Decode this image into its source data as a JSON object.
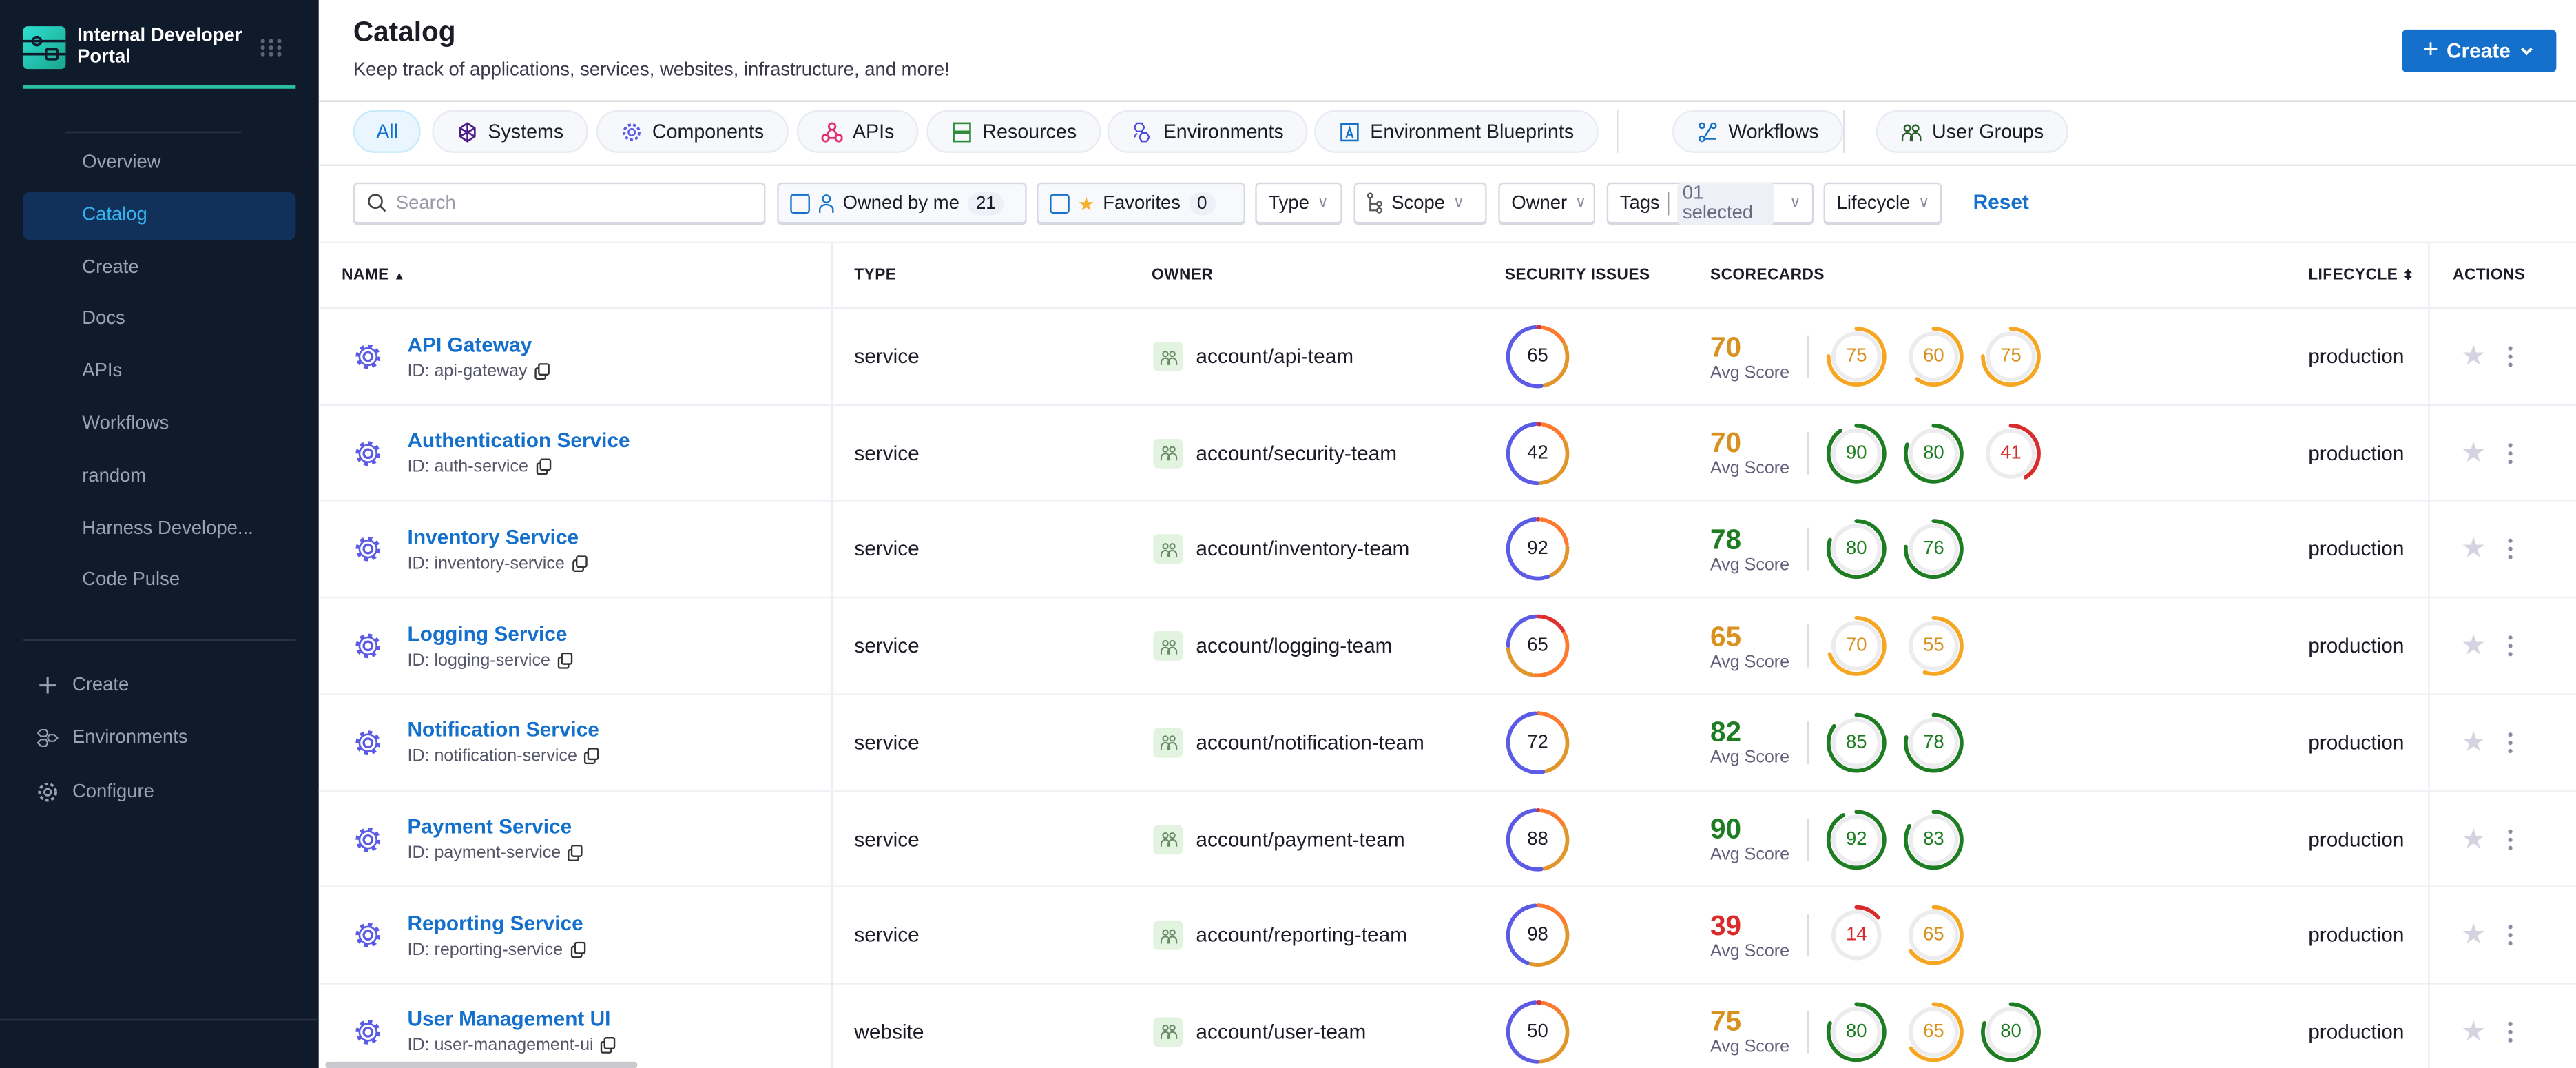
{
  "app": {
    "title": "Internal Developer Portal"
  },
  "sidebar": {
    "items": [
      {
        "label": "Overview"
      },
      {
        "label": "Catalog",
        "active": true
      },
      {
        "label": "Create"
      },
      {
        "label": "Docs"
      },
      {
        "label": "APIs"
      },
      {
        "label": "Workflows"
      },
      {
        "label": "random"
      },
      {
        "label": "Harness Develope..."
      },
      {
        "label": "Code Pulse"
      }
    ],
    "bottom": [
      {
        "label": "Create",
        "icon": "plus-icon"
      },
      {
        "label": "Environments",
        "icon": "environments-icon"
      },
      {
        "label": "Configure",
        "icon": "gear-icon"
      }
    ]
  },
  "header": {
    "title": "Catalog",
    "subtitle": "Keep track of applications, services, websites, infrastructure, and more!",
    "create_label": "Create"
  },
  "tabs": [
    {
      "label": "All",
      "active": true
    },
    {
      "label": "Systems",
      "icon": "systems-icon",
      "color": "#4a1d8a"
    },
    {
      "label": "Components",
      "icon": "gear-icon",
      "color": "#5b5be6"
    },
    {
      "label": "APIs",
      "icon": "webhook-icon",
      "color": "#e0336e"
    },
    {
      "label": "Resources",
      "icon": "server-icon",
      "color": "#2e8b3a"
    },
    {
      "label": "Environments",
      "icon": "hexagons-icon",
      "color": "#4b4be0"
    },
    {
      "label": "Environment Blueprints",
      "icon": "blueprint-icon",
      "color": "#1570cc"
    },
    {
      "label": "Workflows",
      "icon": "workflow-icon",
      "color": "#1570cc"
    },
    {
      "label": "User Groups",
      "icon": "user-group-icon",
      "color": "#2a5e2a"
    }
  ],
  "filters": {
    "search_placeholder": "Search",
    "owned_label": "Owned by me",
    "owned_count": "21",
    "favorites_label": "Favorites",
    "favorites_count": "0",
    "type_label": "Type",
    "scope_label": "Scope",
    "owner_label": "Owner",
    "tags_label": "Tags",
    "tags_value": "01 selected",
    "lifecycle_label": "Lifecycle",
    "reset_label": "Reset"
  },
  "table": {
    "columns": {
      "name": "NAME",
      "type": "TYPE",
      "owner": "OWNER",
      "security": "SECURITY ISSUES",
      "scorecards": "SCORECARDS",
      "lifecycle": "LIFECYCLE",
      "actions": "ACTIONS"
    },
    "avg_label": "Avg Score",
    "security_colors": [
      "#e03030",
      "#ff7a2e",
      "#e0962a",
      "#5b5be6"
    ],
    "rows": [
      {
        "name": "API Gateway",
        "id": "ID: api-gateway",
        "type": "service",
        "owner": "account/api-team",
        "security": "65",
        "security_split": [
          0.03,
          0.15,
          0.3,
          0.52
        ],
        "avg": "70",
        "scores": [
          75,
          60,
          75
        ],
        "lifecycle": "production"
      },
      {
        "name": "Authentication Service",
        "id": "ID: auth-service",
        "type": "service",
        "owner": "account/security-team",
        "security": "42",
        "security_split": [
          0.03,
          0.15,
          0.32,
          0.5
        ],
        "avg": "70",
        "scores": [
          90,
          80,
          41
        ],
        "lifecycle": "production"
      },
      {
        "name": "Inventory Service",
        "id": "ID: inventory-service",
        "type": "service",
        "owner": "account/inventory-team",
        "security": "92",
        "security_split": [
          0.02,
          0.22,
          0.2,
          0.56
        ],
        "avg": "78",
        "scores": [
          80,
          76
        ],
        "lifecycle": "production"
      },
      {
        "name": "Logging Service",
        "id": "ID: logging-service",
        "type": "service",
        "owner": "account/logging-team",
        "security": "65",
        "security_split": [
          0.18,
          0.35,
          0.22,
          0.25
        ],
        "avg": "65",
        "scores": [
          70,
          55
        ],
        "lifecycle": "production"
      },
      {
        "name": "Notification Service",
        "id": "ID: notification-service",
        "type": "service",
        "owner": "account/notification-team",
        "security": "72",
        "security_split": [
          0.01,
          0.16,
          0.3,
          0.53
        ],
        "avg": "82",
        "scores": [
          85,
          78
        ],
        "lifecycle": "production"
      },
      {
        "name": "Payment Service",
        "id": "ID: payment-service",
        "type": "service",
        "owner": "account/payment-team",
        "security": "88",
        "security_split": [
          0.02,
          0.16,
          0.3,
          0.52
        ],
        "avg": "90",
        "scores": [
          92,
          83
        ],
        "lifecycle": "production"
      },
      {
        "name": "Reporting Service",
        "id": "ID: reporting-service",
        "type": "service",
        "owner": "account/reporting-team",
        "security": "98",
        "security_split": [
          0.005,
          0.2,
          0.35,
          0.445
        ],
        "avg": "39",
        "scores": [
          14,
          65
        ],
        "lifecycle": "production"
      },
      {
        "name": "User Management UI",
        "id": "ID: user-management-ui",
        "type": "website",
        "owner": "account/user-team",
        "security": "50",
        "security_split": [
          0.03,
          0.12,
          0.35,
          0.5
        ],
        "avg": "75",
        "scores": [
          80,
          65,
          80
        ],
        "lifecycle": "production"
      }
    ]
  },
  "colors": {
    "accent": "#1570cc",
    "good": "#1e7d22",
    "warn_ring": "#f5a623",
    "warn_text": "#d8901e",
    "bad": "#d92b2b",
    "sidebar_bg": "#0f1a2b"
  }
}
